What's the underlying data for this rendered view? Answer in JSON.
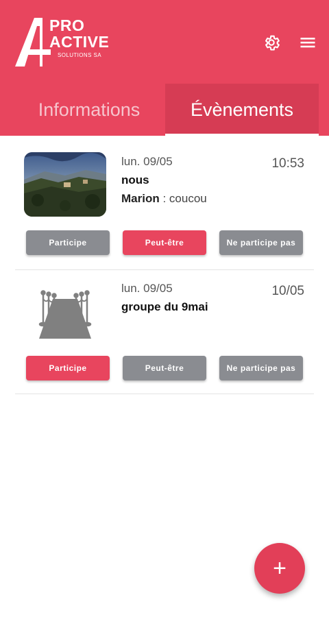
{
  "brand": {
    "line1": "PRO",
    "line2": "ACTIVE",
    "line3": "SOLUTIONS SA",
    "color": "#e8455e"
  },
  "header": {
    "icons": [
      "gear-icon",
      "menu-icon"
    ]
  },
  "tabs": [
    {
      "label": "Informations",
      "active": false
    },
    {
      "label": "Évènements",
      "active": true
    }
  ],
  "events": [
    {
      "date": "lun. 09/05",
      "time": "10:53",
      "title": "nous",
      "last_author": "Marion",
      "last_message": " : coucou",
      "buttons": [
        {
          "label": "Participe",
          "state": "inactive"
        },
        {
          "label": "Peut-être",
          "state": "selected"
        },
        {
          "label": "Ne participe pas",
          "state": "inactive"
        }
      ]
    },
    {
      "date": "lun. 09/05",
      "time": "10/05",
      "title": "groupe du 9mai",
      "buttons": [
        {
          "label": "Participe",
          "state": "selected"
        },
        {
          "label": "Peut-être",
          "state": "inactive"
        },
        {
          "label": "Ne participe pas",
          "state": "inactive"
        }
      ]
    }
  ],
  "fab": {
    "label": "+"
  }
}
